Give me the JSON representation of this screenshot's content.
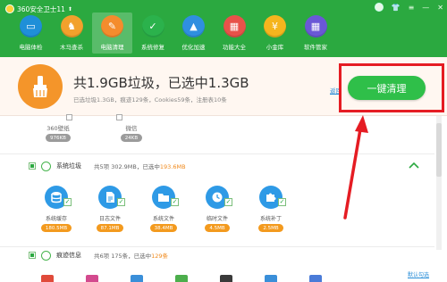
{
  "app": {
    "title": "360安全卫士11"
  },
  "window_controls": {
    "skin": "👕",
    "menu": "≡",
    "minimize": "—",
    "close": "✕"
  },
  "colors": {
    "brand_green": "#2ba940",
    "clean_button": "#2fbf49",
    "highlight_orange": "#f08a1d",
    "annotation_red": "#e51c23"
  },
  "nav": [
    {
      "label": "电脑体检",
      "icon": "monitor-icon",
      "glyph": "▭",
      "color": "#1f8fd8"
    },
    {
      "label": "木马查杀",
      "icon": "horse-icon",
      "glyph": "♞",
      "color": "#f2a12c"
    },
    {
      "label": "电脑清理",
      "icon": "broom-icon",
      "glyph": "✎",
      "color": "#f48c2d",
      "active": true
    },
    {
      "label": "系统修复",
      "icon": "shield-icon",
      "glyph": "✓",
      "color": "#2bb24c"
    },
    {
      "label": "优化加速",
      "icon": "rocket-icon",
      "glyph": "▲",
      "color": "#2f8fe0"
    },
    {
      "label": "功能大全",
      "icon": "grid-icon",
      "glyph": "▦",
      "color": "#e8524a"
    },
    {
      "label": "小金库",
      "icon": "coin-icon",
      "glyph": "¥",
      "color": "#f5b51e"
    },
    {
      "label": "软件管家",
      "icon": "apps-icon",
      "glyph": "▦",
      "color": "#6a58d6"
    }
  ],
  "summary": {
    "title": "共1.9GB垃圾，已选中1.3GB",
    "subtitle": "已选垃圾1.3GB，痕迹129条，Cookies59条，注册表10条",
    "back_link": "返回",
    "clean_button": "一键清理"
  },
  "top_items": [
    {
      "name": "360壁纸",
      "size": "976KB"
    },
    {
      "name": "微信",
      "size": "24KB"
    }
  ],
  "system_junk": {
    "title": "系统垃圾",
    "meta_prefix": "共5项 302.9MB，已选中",
    "meta_selected": "193.6MB",
    "items": [
      {
        "name": "系统缓存",
        "size": "180.5MB",
        "icon": "database-icon"
      },
      {
        "name": "日志文件",
        "size": "87.1MB",
        "icon": "document-icon"
      },
      {
        "name": "系统文件",
        "size": "38.4MB",
        "icon": "folder-icon"
      },
      {
        "name": "临时文件",
        "size": "4.5MB",
        "icon": "clock-icon"
      },
      {
        "name": "系统补丁",
        "size": "2.5MB",
        "icon": "puzzle-icon"
      }
    ]
  },
  "traces": {
    "title": "痕迹信息",
    "meta_prefix": "共6项 175条，已选中",
    "meta_selected": "129条"
  },
  "default_link": "默认勾选"
}
